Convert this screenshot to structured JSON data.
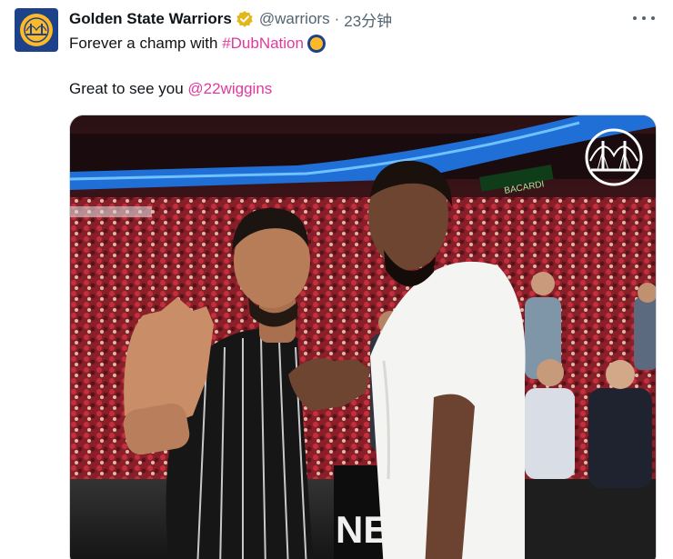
{
  "tweet": {
    "display_name": "Golden State Warriors",
    "handle": "@warriors",
    "separator": "·",
    "timestamp": "23分钟",
    "line1_text": "Forever a champ with ",
    "hashtag": "#DubNation",
    "line2_text": "Great to see you ",
    "mention": "@22wiggins"
  },
  "media": {
    "arena_sign": "NEX",
    "arena_ribbon": "BACARDI"
  },
  "colors": {
    "brand_blue": "#1d428a",
    "brand_gold": "#fdb927",
    "link_pink": "#e0399e",
    "verified_gold": "#e2b719",
    "muted_text": "#536471"
  },
  "icons": [
    "warriors-logo-icon",
    "verified-badge-icon",
    "more-options-icon",
    "dubnation-emoji-icon",
    "bridge-logo-icon"
  ]
}
